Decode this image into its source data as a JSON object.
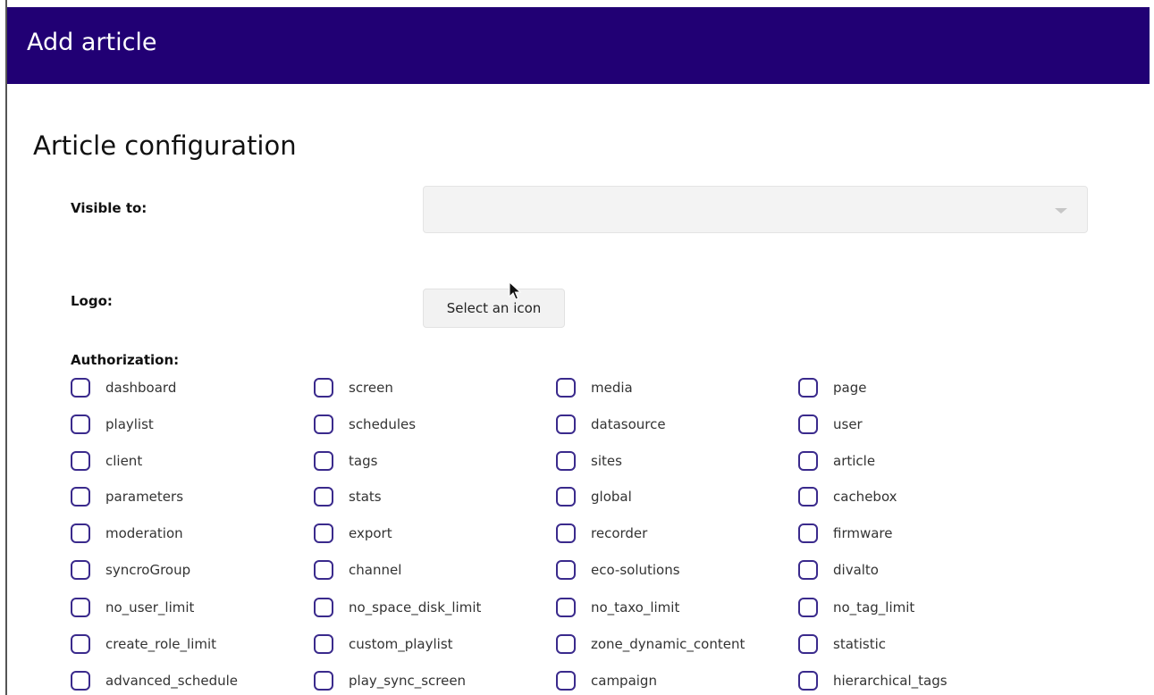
{
  "header": {
    "title": "Add article",
    "bg_color": "#210074"
  },
  "section": {
    "title": "Article configuration"
  },
  "fields": {
    "visible_to_label": "Visible to:",
    "visible_to_value": "",
    "logo_label": "Logo:",
    "select_icon_button": "Select an icon",
    "authorization_label": "Authorization:"
  },
  "authorization": {
    "checkbox_border_color": "#3a2a8c",
    "columns": [
      [
        {
          "label": "dashboard",
          "checked": false
        },
        {
          "label": "playlist",
          "checked": false
        },
        {
          "label": "client",
          "checked": false
        },
        {
          "label": "parameters",
          "checked": false
        },
        {
          "label": "moderation",
          "checked": false
        },
        {
          "label": "syncroGroup",
          "checked": false
        },
        {
          "label": "no_user_limit",
          "checked": false
        },
        {
          "label": "create_role_limit",
          "checked": false
        },
        {
          "label": "advanced_schedule",
          "checked": false
        }
      ],
      [
        {
          "label": "screen",
          "checked": false
        },
        {
          "label": "schedules",
          "checked": false
        },
        {
          "label": "tags",
          "checked": false
        },
        {
          "label": "stats",
          "checked": false
        },
        {
          "label": "export",
          "checked": false
        },
        {
          "label": "channel",
          "checked": false
        },
        {
          "label": "no_space_disk_limit",
          "checked": false
        },
        {
          "label": "custom_playlist",
          "checked": false
        },
        {
          "label": "play_sync_screen",
          "checked": false
        }
      ],
      [
        {
          "label": "media",
          "checked": false
        },
        {
          "label": "datasource",
          "checked": false
        },
        {
          "label": "sites",
          "checked": false
        },
        {
          "label": "global",
          "checked": false
        },
        {
          "label": "recorder",
          "checked": false
        },
        {
          "label": "eco-solutions",
          "checked": false
        },
        {
          "label": "no_taxo_limit",
          "checked": false
        },
        {
          "label": "zone_dynamic_content",
          "checked": false
        },
        {
          "label": "campaign",
          "checked": false
        }
      ],
      [
        {
          "label": "page",
          "checked": false
        },
        {
          "label": "user",
          "checked": false
        },
        {
          "label": "article",
          "checked": false
        },
        {
          "label": "cachebox",
          "checked": false
        },
        {
          "label": "firmware",
          "checked": false
        },
        {
          "label": "divalto",
          "checked": false
        },
        {
          "label": "no_tag_limit",
          "checked": false
        },
        {
          "label": "statistic",
          "checked": false
        },
        {
          "label": "hierarchical_tags",
          "checked": false
        }
      ]
    ]
  },
  "icons": {
    "dropdown": "chevron-down-icon",
    "cursor": "mouse-pointer-icon"
  }
}
